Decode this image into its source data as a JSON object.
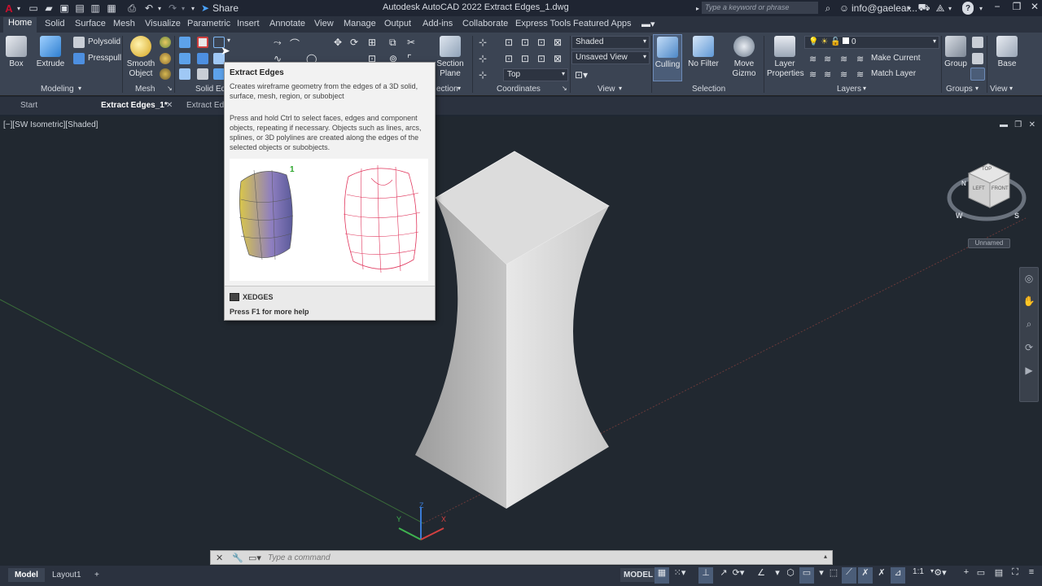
{
  "titlebar": {
    "app_title": "Autodesk AutoCAD 2022    Extract Edges_1.dwg",
    "share_label": "Share",
    "search_placeholder": "Type a keyword or phrase",
    "user": "info@gaelear...",
    "colors": {
      "brand": "#c8102e"
    }
  },
  "ribbon_tabs": [
    "Home",
    "Solid",
    "Surface",
    "Mesh",
    "Visualize",
    "Parametric",
    "Insert",
    "Annotate",
    "View",
    "Manage",
    "Output",
    "Add-ins",
    "Collaborate",
    "Express Tools",
    "Featured Apps"
  ],
  "ribbon": {
    "box": "Box",
    "extrude": "Extrude",
    "polysolid": "Polysolid",
    "presspull": "Presspull",
    "smooth_object_1": "Smooth",
    "smooth_object_2": "Object",
    "section_plane_1": "Section",
    "section_plane_2": "Plane",
    "visual_style": "Shaded",
    "saved_view": "Unsaved View",
    "view_direction": "Top",
    "culling": "Culling",
    "no_filter": "No Filter",
    "move_gizmo_1": "Move",
    "move_gizmo_2": "Gizmo",
    "layer_properties_1": "Layer",
    "layer_properties_2": "Properties",
    "layer_current": "0",
    "make_current": "Make Current",
    "match_layer": "Match Layer",
    "group": "Group",
    "base": "Base",
    "panels": {
      "modeling": "Modeling",
      "mesh": "Mesh",
      "solid_editing": "Solid Ed",
      "section": "ection",
      "coordinates": "Coordinates",
      "view": "View",
      "selection": "Selection",
      "layers": "Layers",
      "groups": "Groups",
      "view2": "View"
    }
  },
  "doc_tabs": {
    "start": "Start",
    "active": "Extract Edges_1*",
    "other": "Extract Edg"
  },
  "viewport": {
    "label": "[−][SW Isometric][Shaded]",
    "viewcube_top": "TOP",
    "viewcube_left": "LEFT",
    "viewcube_front": "FRONT",
    "compass_w": "W",
    "compass_s": "S",
    "compass_n": "N",
    "ucs_name": "Unnamed",
    "axis_x": "X",
    "axis_y": "Y",
    "axis_z": "Z"
  },
  "tooltip": {
    "title": "Extract Edges",
    "description": "Creates wireframe geometry from the edges of a 3D solid, surface, mesh, region, or subobject",
    "detail": "Press and hold Ctrl to select faces, edges and component objects, repeating if necessary. Objects such as lines, arcs, splines, or 3D polylines are created along the edges of the selected objects or subobjects.",
    "image_badge": "1",
    "command": "XEDGES",
    "help": "Press F1 for more help"
  },
  "command_line": {
    "placeholder": "Type a command"
  },
  "status_bar": {
    "model_tab": "Model",
    "layout_tab": "Layout1",
    "add_tab": "+",
    "model_button": "MODEL",
    "scale": "1:1"
  }
}
